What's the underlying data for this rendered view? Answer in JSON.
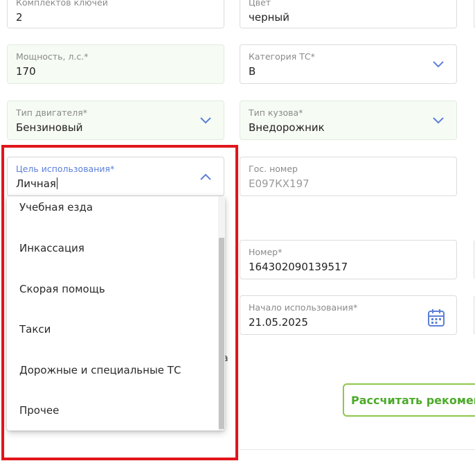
{
  "fields": {
    "keys": {
      "label": "Комплектов ключей",
      "value": "2"
    },
    "color": {
      "label": "Цвет",
      "value": "черный"
    },
    "power": {
      "label": "Мощность, л.с.*",
      "value": "170"
    },
    "category": {
      "label": "Категория ТС*",
      "value": "B"
    },
    "engine": {
      "label": "Тип двигателя*",
      "value": "Бензиновый"
    },
    "body": {
      "label": "Тип кузова*",
      "value": "Внедорожник"
    },
    "purpose": {
      "label": "Цель использования*",
      "value": "Личная"
    },
    "plate": {
      "label": "Гос. номер",
      "placeholder": "Е097КХ197"
    },
    "number": {
      "label": "Номер*",
      "value": "16430209013951​7"
    },
    "start": {
      "label": "Начало использования*",
      "value": "21.05.2025"
    }
  },
  "dropdown": {
    "options": [
      "Учебная езда",
      "Инкассация",
      "Скорая помощь",
      "Такси",
      "Дорожные и специальные ТС",
      "Прочее"
    ]
  },
  "stray_char": "а",
  "calc_button": "Рассчитать рекоменд",
  "colors": {
    "accent_green": "#4caa2b",
    "highlight_red": "#e0161b",
    "active_label_blue": "#5b7fd9"
  },
  "icons": [
    "chevron-down-icon",
    "chevron-up-icon",
    "calendar-icon"
  ]
}
